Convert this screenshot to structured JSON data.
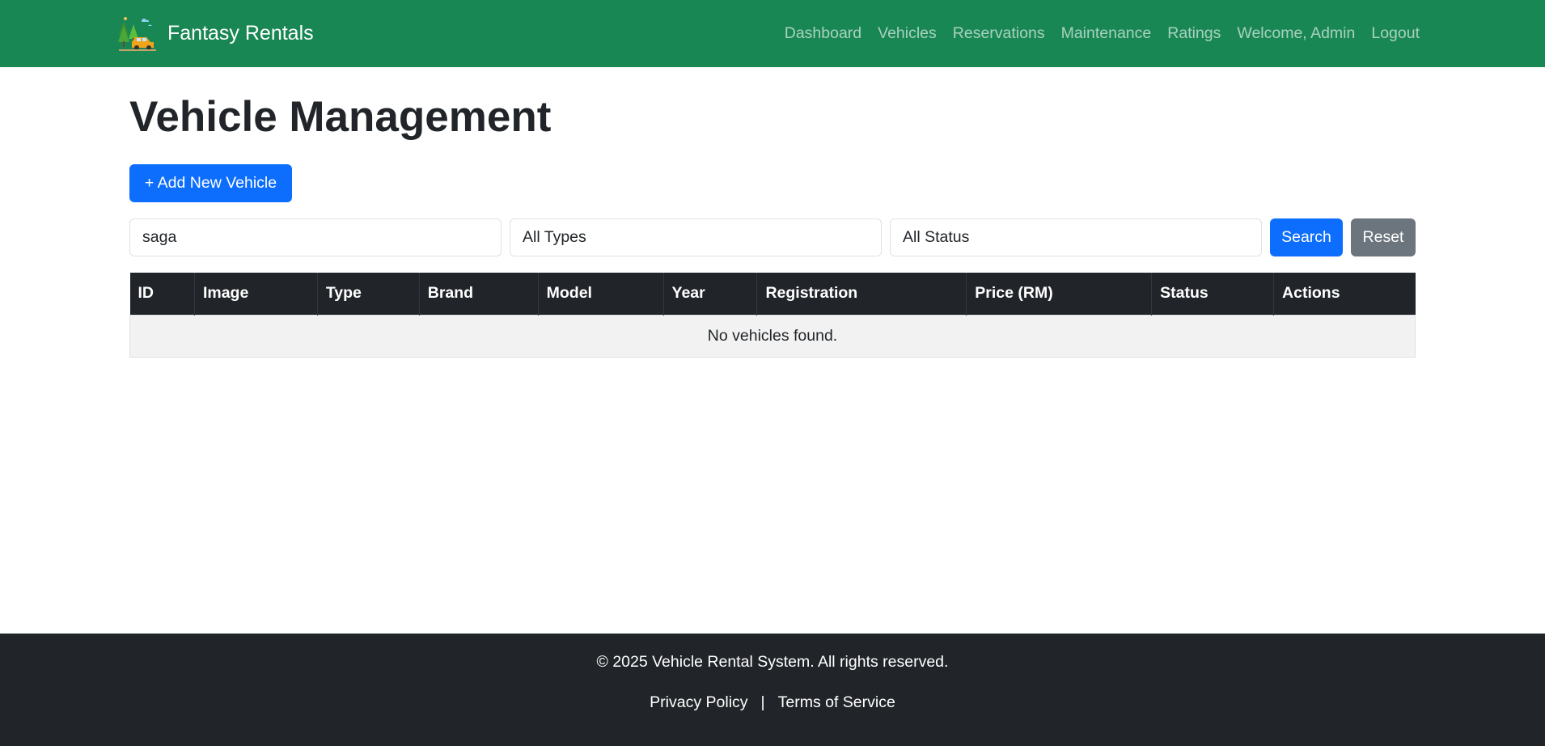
{
  "navbar": {
    "brand": "Fantasy Rentals",
    "logo_icon": "car-trees-logo-icon",
    "links": [
      "Dashboard",
      "Vehicles",
      "Reservations",
      "Maintenance",
      "Ratings",
      "Welcome, Admin",
      "Logout"
    ]
  },
  "main": {
    "title": "Vehicle Management",
    "add_button": "+ Add New Vehicle",
    "filters": {
      "search_value": "saga",
      "type_selected": "All Types",
      "status_selected": "All Status",
      "search_button": "Search",
      "reset_button": "Reset"
    },
    "table": {
      "columns": [
        "ID",
        "Image",
        "Type",
        "Brand",
        "Model",
        "Year",
        "Registration",
        "Price (RM)",
        "Status",
        "Actions"
      ],
      "empty_message": "No vehicles found."
    }
  },
  "footer": {
    "copyright": "© 2025 Vehicle Rental System. All rights reserved.",
    "links": [
      "Privacy Policy",
      "Terms of Service"
    ],
    "separator": "|"
  },
  "colors": {
    "navbar": "#198754",
    "primary": "#0d6efd",
    "secondary": "#6c757d",
    "dark": "#212529"
  }
}
